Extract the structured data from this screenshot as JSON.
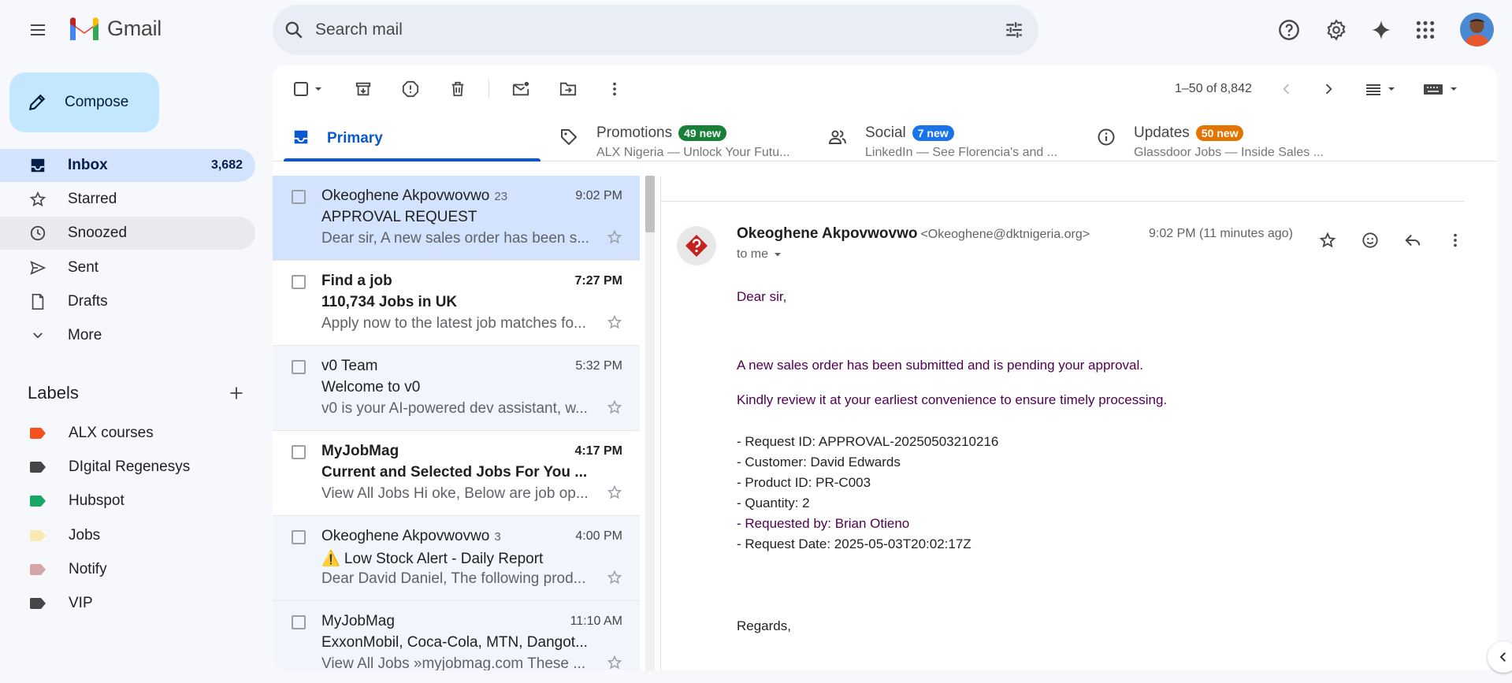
{
  "app": {
    "name": "Gmail",
    "search_placeholder": "Search mail"
  },
  "compose": {
    "label": "Compose"
  },
  "nav": [
    {
      "label": "Inbox",
      "count": "3,682",
      "icon": "inbox-icon"
    },
    {
      "label": "Starred",
      "count": "",
      "icon": "star-icon"
    },
    {
      "label": "Snoozed",
      "count": "",
      "icon": "clock-icon"
    },
    {
      "label": "Sent",
      "count": "",
      "icon": "send-icon"
    },
    {
      "label": "Drafts",
      "count": "",
      "icon": "draft-icon"
    },
    {
      "label": "More",
      "count": "",
      "icon": "chevron-down-icon"
    }
  ],
  "labels": {
    "title": "Labels",
    "items": [
      {
        "label": "ALX courses",
        "color": "#f4511e"
      },
      {
        "label": "DIgital Regenesys",
        "color": "#444746"
      },
      {
        "label": "Hubspot",
        "color": "#16a765"
      },
      {
        "label": "Jobs",
        "color": "#fce8b3"
      },
      {
        "label": "Notify",
        "color": "#d5a6a8"
      },
      {
        "label": "VIP",
        "color": "#444746"
      }
    ]
  },
  "toolbar": {
    "page_range": "1–50 of 8,842"
  },
  "tabs": [
    {
      "title": "Primary",
      "badge": "",
      "sub": ""
    },
    {
      "title": "Promotions",
      "badge": "49 new",
      "badge_color": "#188038",
      "sub": "ALX Nigeria — Unlock Your Futu..."
    },
    {
      "title": "Social",
      "badge": "7 new",
      "badge_color": "#1a73e8",
      "sub": "LinkedIn — See Florencia's and ..."
    },
    {
      "title": "Updates",
      "badge": "50 new",
      "badge_color": "#e37400",
      "sub": "Glassdoor Jobs — Inside Sales ..."
    }
  ],
  "mails": [
    {
      "sender": "Okeoghene Akpovwovwo",
      "count": "23",
      "time": "9:02 PM",
      "subject": "APPROVAL REQUEST",
      "snippet": "Dear sir, A new sales order has been s..."
    },
    {
      "sender": "Find a job",
      "count": "",
      "time": "7:27 PM",
      "subject": "110,734 Jobs in UK",
      "snippet": "Apply now to the latest job matches fo..."
    },
    {
      "sender": "v0 Team",
      "count": "",
      "time": "5:32 PM",
      "subject": "Welcome to v0",
      "snippet": "v0 is your AI-powered dev assistant, w..."
    },
    {
      "sender": "MyJobMag",
      "count": "",
      "time": "4:17 PM",
      "subject": "Current and Selected Jobs For You ...",
      "snippet": "View All Jobs Hi oke, Below are job op..."
    },
    {
      "sender": "Okeoghene Akpovwovwo",
      "count": "3",
      "time": "4:00 PM",
      "subject": "⚠️ Low Stock Alert - Daily Report",
      "snippet": "Dear David Daniel, The following prod..."
    },
    {
      "sender": "MyJobMag",
      "count": "",
      "time": "11:10 AM",
      "subject": "ExxonMobil, Coca-Cola, MTN, Dangot...",
      "snippet": "View All Jobs »myjobmag.com These ..."
    }
  ],
  "reader": {
    "from_name": "Okeoghene Akpovwovwo",
    "from_email": "<Okeoghene@dktnigeria.org>",
    "to": "to me",
    "time": "9:02 PM (11 minutes ago)",
    "body": [
      "Dear sir,",
      "A new sales order has been submitted and is pending your approval.",
      "Kindly review it at your earliest convenience to ensure timely processing.",
      "- Request ID: APPROVAL-20250503210216",
      "- Customer: David Edwards",
      "- Product ID: PR-C003",
      "- Quantity: 2",
      "- Requested by: Brian Otieno",
      "- Request Date: 2025-05-03T20:02:17Z",
      "Regards,"
    ]
  }
}
